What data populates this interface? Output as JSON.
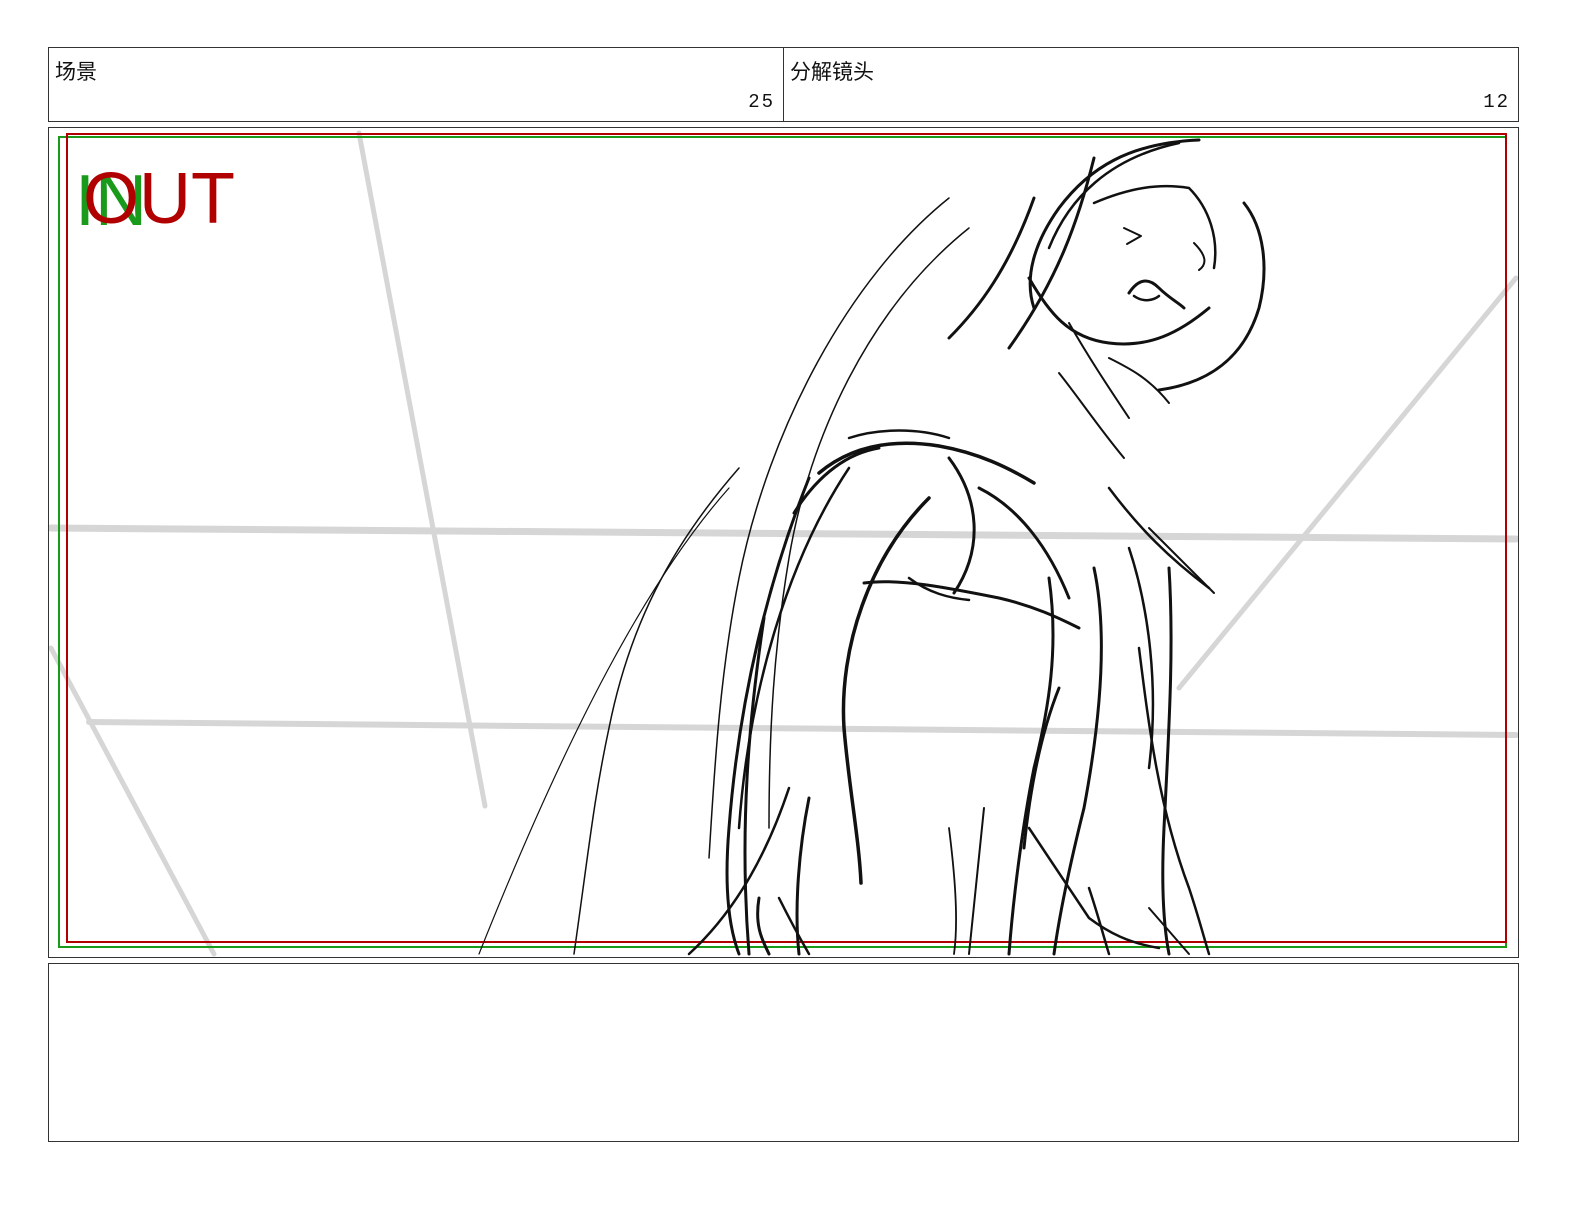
{
  "header": {
    "scene_label": "场景",
    "scene_number": "25",
    "shot_label": "分解镜头",
    "shot_number": "12"
  },
  "frame": {
    "in_tag": "IN",
    "out_tag": "OUT",
    "colors": {
      "in": "#1a9a1a",
      "out": "#b00000",
      "sketch": "#111111",
      "guide": "#d6d6d6"
    }
  },
  "notes": {
    "text": ""
  }
}
